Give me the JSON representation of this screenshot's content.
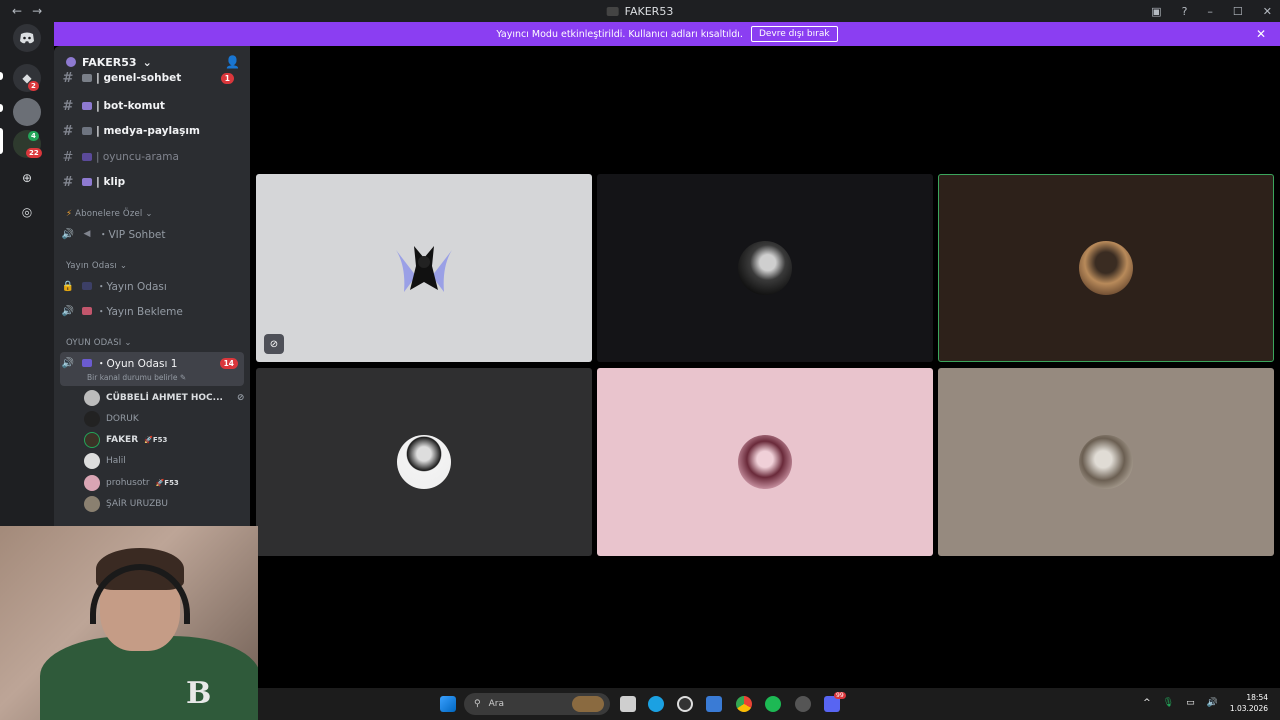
{
  "window": {
    "title": "FAKER53",
    "back": "←",
    "forward": "→",
    "help_icon": "?",
    "minimize": "–",
    "maximize": "☐",
    "close": "✕"
  },
  "banner": {
    "text": "Yayıncı Modu etkinleştirildi. Kullanıcı adları kısaltıldı.",
    "button": "Devre dışı bırak",
    "close": "✕"
  },
  "rail": {
    "badge_1": "2",
    "badge_2": "4",
    "badge_3": "22"
  },
  "sidebar": {
    "server_name": "FAKER53",
    "channels": [
      {
        "name": "| genel-sohbet",
        "badge": "1"
      },
      {
        "name": "| bot-komut"
      },
      {
        "name": "| medya-paylaşım"
      },
      {
        "name": "| oyuncu-arama"
      },
      {
        "name": "| klip"
      }
    ],
    "cat_subs": "Abonelere Özel",
    "vip": "・VIP Sohbet",
    "cat_stream": "Yayın Odası",
    "stream_room": "・Yayın Odası",
    "stream_wait": "・Yayın Bekleme",
    "cat_game": "OYUN ODASI",
    "game_room": "・Oyun Odası 1",
    "game_room_count": "14",
    "status_hint": "Bir kanal durumu belirle",
    "members": [
      {
        "name": "CÜBBELİ AHMET HOC..."
      },
      {
        "name": "DORUK"
      },
      {
        "name": "FAKER",
        "tag": "F53"
      },
      {
        "name": "Halil"
      },
      {
        "name": "prohusotr",
        "tag": "F53"
      },
      {
        "name": "ŞAİR URUZBU"
      }
    ]
  },
  "taskbar": {
    "search": "Ara",
    "time": "18:54",
    "date": "1.03.2026",
    "discord_badge": "99"
  },
  "colors": {
    "banner": "#8b3ef2",
    "speaking_border": "#3ba55c",
    "tile_1": "#d5d6d8",
    "tile_2": "#141417",
    "tile_3": "#2d211a",
    "tile_4": "#2f2f30",
    "tile_5": "#e9c4cd",
    "tile_6": "#968a7f"
  }
}
